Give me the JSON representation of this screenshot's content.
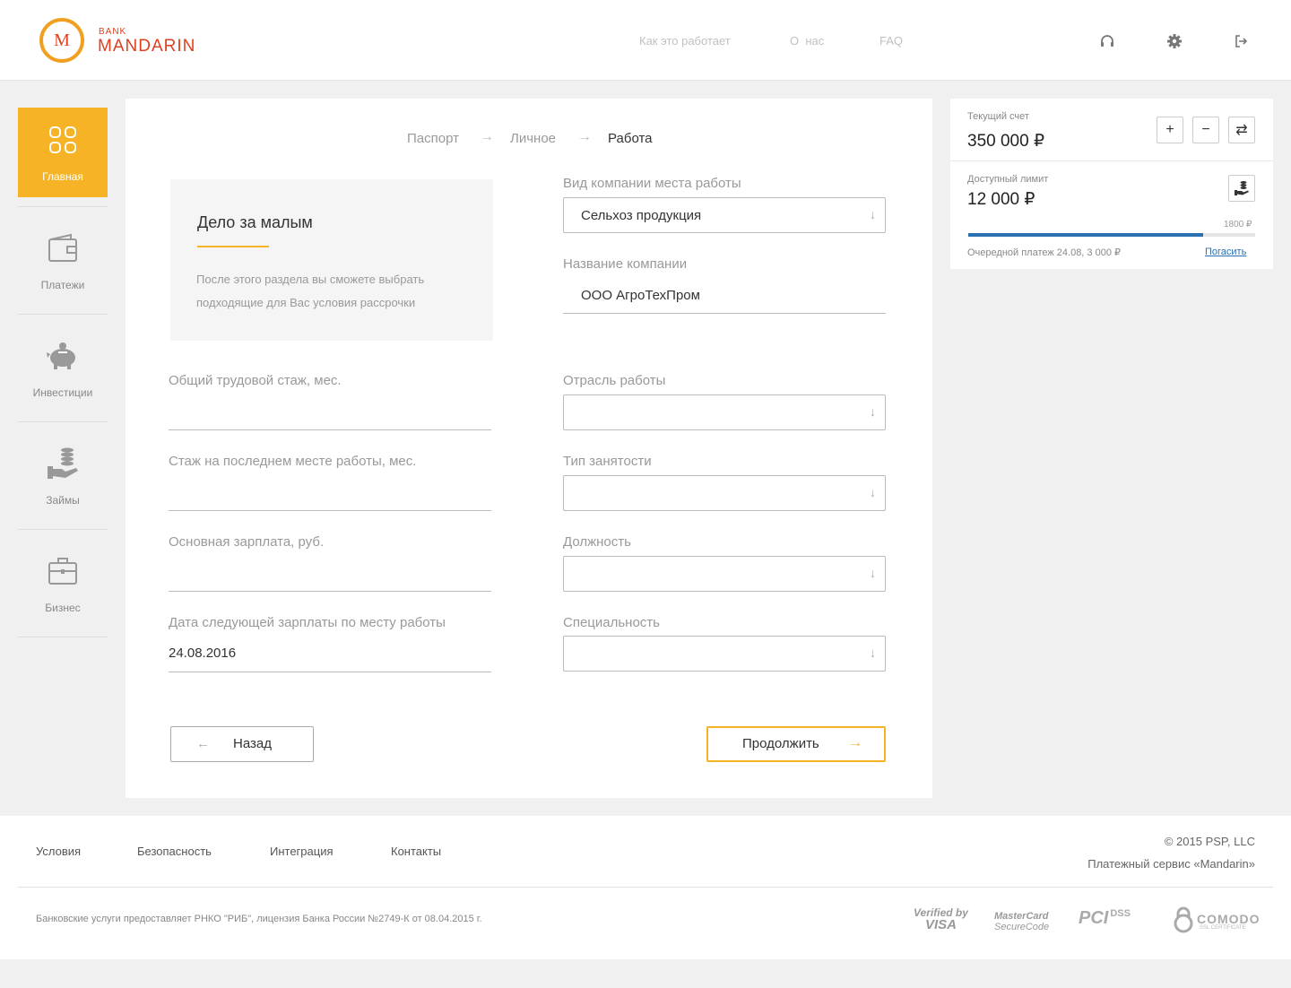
{
  "header": {
    "logo_letter": "M",
    "logo_bank": "BANK",
    "logo_name": "MANDARIN",
    "nav": [
      "Как это работает",
      "О  нас",
      "FAQ"
    ],
    "icons": [
      "headphones-icon",
      "gear-icon",
      "logout-icon"
    ]
  },
  "sidebar": {
    "items": [
      {
        "label": "Главная",
        "icon": "grid-icon",
        "active": true
      },
      {
        "label": "Платежи",
        "icon": "wallet-icon"
      },
      {
        "label": "Инвестиции",
        "icon": "piggy-bank-icon"
      },
      {
        "label": "Займы",
        "icon": "hand-coins-icon"
      },
      {
        "label": "Бизнес",
        "icon": "briefcase-icon"
      }
    ]
  },
  "breadcrumb": {
    "steps": [
      "Паспорт",
      "Личное",
      "Работа"
    ],
    "arrow": "→"
  },
  "info": {
    "title": "Дело за малым",
    "text": "После этого раздела вы сможете выбрать подходящие для Вас условия рассрочки"
  },
  "form": {
    "left": [
      {
        "label": "Общий трудовой стаж, мес.",
        "value": ""
      },
      {
        "label": "Стаж на последнем месте работы, мес.",
        "value": ""
      },
      {
        "label": "Основная зарплата, руб.",
        "value": ""
      },
      {
        "label": "Дата следующей зарплаты по месту работы",
        "value": "24.08.2016"
      }
    ],
    "company_type": {
      "label": "Вид компании места работы",
      "value": "Сельхоз продукция"
    },
    "company_name": {
      "label": "Название компании",
      "value": "ООО АгроТехПром"
    },
    "industry": {
      "label": "Отрасль работы",
      "value": ""
    },
    "employment": {
      "label": "Тип занятости",
      "value": ""
    },
    "position": {
      "label": "Должность",
      "value": ""
    },
    "specialty": {
      "label": "Специальность",
      "value": ""
    },
    "select_arrow": "↓"
  },
  "buttons": {
    "back": "Назад",
    "back_arrow": "←",
    "next": "Продолжить",
    "next_arrow": "→"
  },
  "account": {
    "current_label": "Текущий счет",
    "current_value": "350 000 ₽",
    "plus": "+",
    "minus": "−",
    "swap": "⇄",
    "limit_label": "Доступный лимит",
    "limit_value": "12 000 ₽",
    "progress_cap": "1800 ₽",
    "progress_fraction": 0.82,
    "next_payment": "Очередной платеж 24.08, 3 000 ₽",
    "repay": "Погасить",
    "accent": "#2a6faf"
  },
  "footer": {
    "links": [
      "Условия",
      "Безопасность",
      "Интеграция",
      "Контакты"
    ],
    "copyright": "© 2015 PSP, LLC",
    "service": "Платежный сервис «Mandarin»",
    "legal": "Банковские услуги предоставляет РНКО \"РИБ\", лицензия Банка России №2749-К от 08.04.2015 г.",
    "badges": {
      "visa_top": "Verified by",
      "visa_bottom": "VISA",
      "mc_top": "MasterCard",
      "mc_bottom": "SecureCode",
      "pci": "PCI",
      "dss": "DSS",
      "comodo": "COMODO",
      "comodo_sub": "SSL CERTIFICATE"
    }
  },
  "colors": {
    "brand": "#e04020",
    "accent": "#f5b325"
  }
}
